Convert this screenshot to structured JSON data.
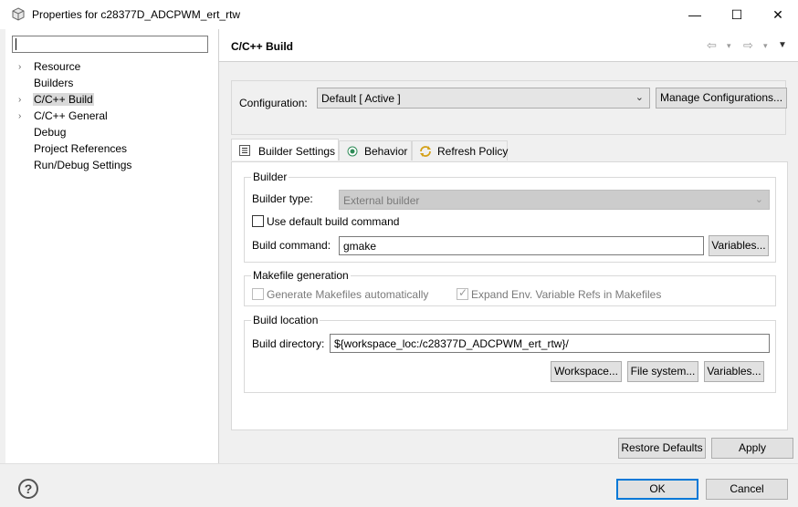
{
  "window": {
    "title": "Properties for c28377D_ADCPWM_ert_rtw",
    "minimize_glyph": "—",
    "maximize_glyph": "☐",
    "close_glyph": "✕"
  },
  "sidebar": {
    "filter_value": "",
    "items": [
      {
        "label": "Resource",
        "expandable": true
      },
      {
        "label": "Builders",
        "expandable": false
      },
      {
        "label": "C/C++ Build",
        "expandable": true,
        "selected": true
      },
      {
        "label": "C/C++ General",
        "expandable": true
      },
      {
        "label": "Debug",
        "expandable": false
      },
      {
        "label": "Project References",
        "expandable": false
      },
      {
        "label": "Run/Debug Settings",
        "expandable": false
      }
    ],
    "arrow_glyph": "›"
  },
  "page": {
    "title": "C/C++ Build",
    "nav": {
      "back": "⇦",
      "forward": "⇨",
      "dropdown": "▾",
      "menu": "▼"
    }
  },
  "configuration": {
    "label": "Configuration:",
    "value": "Default  [ Active ]",
    "chevron": "⌄",
    "manage_button": "Manage Configurations..."
  },
  "tabs": [
    {
      "label": "Builder Settings",
      "active": true,
      "icon": "list-icon"
    },
    {
      "label": "Behavior",
      "active": false,
      "icon": "radio-icon"
    },
    {
      "label": "Refresh Policy",
      "active": false,
      "icon": "refresh-icon"
    }
  ],
  "builder": {
    "group_title": "Builder",
    "type_label": "Builder type:",
    "type_value": "External builder",
    "use_default_label": "Use default build command",
    "use_default_checked": false,
    "command_label": "Build command:",
    "command_value": "gmake",
    "variables_button": "Variables..."
  },
  "makefile": {
    "group_title": "Makefile generation",
    "generate_label": "Generate Makefiles automatically",
    "generate_checked": false,
    "expand_label": "Expand Env. Variable Refs in Makefiles",
    "expand_checked": true,
    "check_glyph": "✓"
  },
  "location": {
    "group_title": "Build location",
    "directory_label": "Build directory:",
    "directory_value": "${workspace_loc:/c28377D_ADCPWM_ert_rtw}/",
    "workspace_button": "Workspace...",
    "filesystem_button": "File system...",
    "variables_button": "Variables..."
  },
  "page_buttons": {
    "restore": "Restore Defaults",
    "apply": "Apply"
  },
  "footer": {
    "help": "?",
    "ok": "OK",
    "cancel": "Cancel"
  },
  "colors": {
    "accent": "#0078d7",
    "selection": "#d9d9d9",
    "background": "#f0f0f0"
  }
}
